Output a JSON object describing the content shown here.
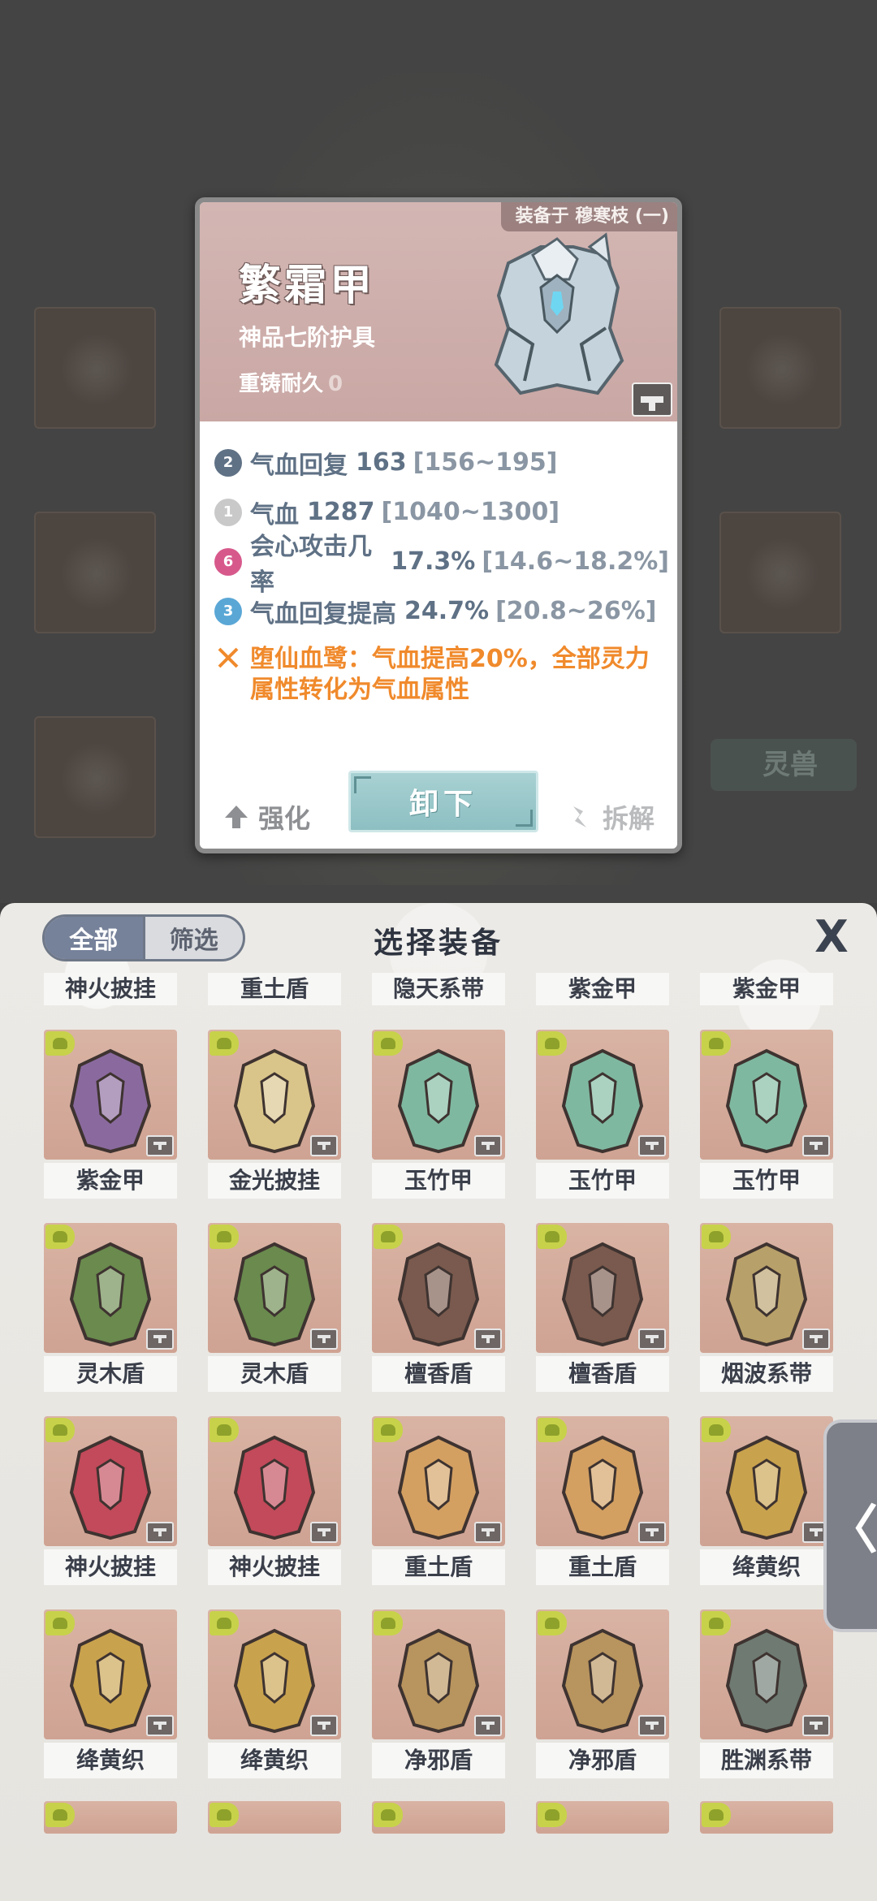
{
  "background": {
    "beast_label": "灵兽"
  },
  "card": {
    "equipped_label": "装备于 穆寒枝 (一)",
    "name": "繁霜甲",
    "grade": "神品七阶护具",
    "reforge_label": "重铸耐久",
    "reforge_value": "0",
    "stats": [
      {
        "icon_num": "2",
        "icon_color": "#5f7185",
        "label": "气血回复",
        "value": "163",
        "range": "[156~195]"
      },
      {
        "icon_num": "1",
        "icon_color": "#c9c9c9",
        "label": "气血",
        "value": "1287",
        "range": "[1040~1300]"
      },
      {
        "icon_num": "6",
        "icon_color": "#d7598c",
        "label": "会心攻击几率",
        "value": "17.3%",
        "range": "[14.6~18.2%]"
      },
      {
        "icon_num": "3",
        "icon_color": "#5aa7d6",
        "label": "气血回复提高",
        "value": "24.7%",
        "range": "[20.8~26%]"
      }
    ],
    "special_text": "堕仙血鹭：气血提高20%，全部灵力属性转化为气血属性",
    "enhance_label": "强化",
    "unequip_label": "卸下",
    "dismantle_label": "拆解"
  },
  "panel": {
    "tab_all": "全部",
    "tab_filter": "筛选",
    "title": "选择装备",
    "close_glyph": "X",
    "top_partial_names": [
      "神火披挂",
      "重土盾",
      "隐天系带",
      "紫金甲",
      "紫金甲"
    ],
    "rows": [
      [
        "紫金甲",
        "金光披挂",
        "玉竹甲",
        "玉竹甲",
        "玉竹甲"
      ],
      [
        "灵木盾",
        "灵木盾",
        "檀香盾",
        "檀香盾",
        "烟波系带"
      ],
      [
        "神火披挂",
        "神火披挂",
        "重土盾",
        "重土盾",
        "绛黄织"
      ],
      [
        "绛黄织",
        "绛黄织",
        "净邪盾",
        "净邪盾",
        "胜渊系带"
      ]
    ],
    "side_tab_glyph": "〈"
  },
  "colors": {
    "accent": "#76819a",
    "special": "#f08a2c",
    "stat": "#5f7185"
  }
}
